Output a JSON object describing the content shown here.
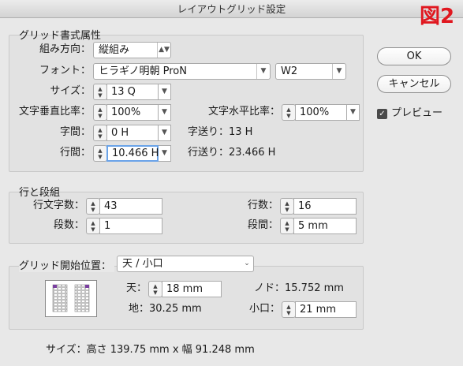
{
  "window": {
    "title": "レイアウトグリッド設定"
  },
  "badge": "図2",
  "grid_attr": {
    "title": "グリッド書式属性",
    "direction_label": "組み方向：",
    "direction_value": "縦組み",
    "font_label": "フォント：",
    "font_family": "ヒラギノ明朝 ProN",
    "font_style": "W2",
    "size_label": "サイズ：",
    "size_value": "13 Q",
    "vscale_label": "文字垂直比率：",
    "vscale_value": "100%",
    "hscale_label": "文字水平比率：",
    "hscale_value": "100%",
    "char_gap_label": "字間：",
    "char_gap_value": "0 H",
    "char_pitch": "字送り：13 H",
    "line_gap_label": "行間：",
    "line_gap_value": "10.466 H",
    "line_pitch": "行送り：23.466 H"
  },
  "rows_cols": {
    "title": "行と段組",
    "chars_label": "行文字数：",
    "chars_value": "43",
    "lines_label": "行数：",
    "lines_value": "16",
    "columns_label": "段数：",
    "columns_value": "1",
    "gutter_label": "段間：",
    "gutter_value": "5 mm"
  },
  "start": {
    "title": "グリッド開始位置：",
    "select_value": "天 / 小口",
    "top_label": "天：",
    "top_value": "18 mm",
    "gutter_text": "ノド：15.752 mm",
    "bottom_text": "地：30.25 mm",
    "fore_label": "小口：",
    "fore_value": "21 mm"
  },
  "buttons": {
    "ok": "OK",
    "cancel": "キャンセル",
    "preview": "プレビュー",
    "preview_checked": true
  },
  "footer": {
    "size_text": "サイズ：高さ 139.75 mm x 幅 91.248 mm"
  }
}
